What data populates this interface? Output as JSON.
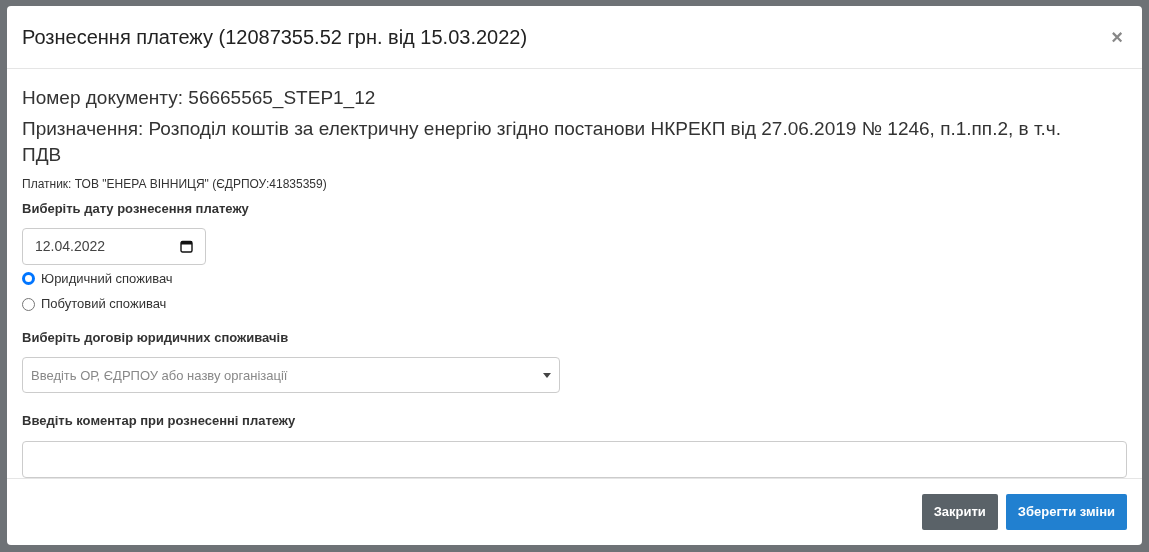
{
  "modal": {
    "title": "Рознесення платежу (12087355.52 грн. від 15.03.2022)",
    "close": "×"
  },
  "document_number": "Номер документу: 56665565_STEP1_12",
  "purpose": "Призначення: Розподіл коштів за електричну енергію згідно постанови НКРЕКП від 27.06.2019 № 1246, п.1.пп.2, в т.ч. ПДВ",
  "payer": "Платник: ТОВ \"ЕНЕРА ВІННИЦЯ\" (ЄДРПОУ:41835359)",
  "date_field": {
    "label": "Виберіть дату рознесення платежу",
    "value": "12.04.2022"
  },
  "consumer_types": [
    {
      "label": "Юридичний споживач",
      "selected": true
    },
    {
      "label": "Побутовий споживач",
      "selected": false
    }
  ],
  "contract_select": {
    "label": "Виберіть договір юридичних споживачів",
    "placeholder": "Введіть ОР, ЄДРПОУ або назву організації"
  },
  "comment_field": {
    "label": "Введіть коментар при рознесенні платежу"
  },
  "buttons": [
    {
      "label": "Закрити",
      "kind": "secondary"
    },
    {
      "label": "Зберегти зміни",
      "kind": "primary"
    }
  ]
}
